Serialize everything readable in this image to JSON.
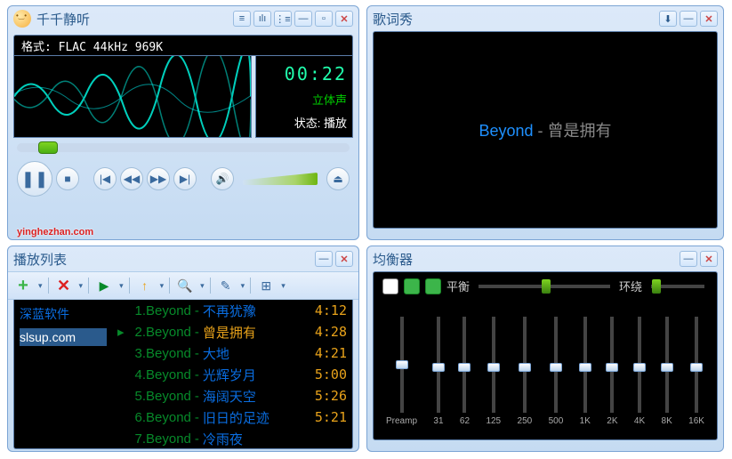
{
  "player": {
    "title": "千千静听",
    "format": "格式: FLAC 44kHz 969K",
    "time": "00:22",
    "stereo": "立体声",
    "status": "状态: 播放",
    "watermark": "yinghezhan.com"
  },
  "lyric": {
    "title": "歌词秀",
    "current_artist": "Beyond",
    "sep": " - ",
    "current_song": "曾是拥有"
  },
  "playlist": {
    "title": "播放列表",
    "side": [
      {
        "label": "深蓝软件"
      },
      {
        "label": "slsup.com",
        "selected": true
      }
    ],
    "tracks": [
      {
        "n": "1",
        "artist": "Beyond",
        "name": "不再犹豫",
        "dur": "4:12",
        "current": false
      },
      {
        "n": "2",
        "artist": "Beyond",
        "name": "曾是拥有",
        "dur": "4:28",
        "current": true
      },
      {
        "n": "3",
        "artist": "Beyond",
        "name": "大地",
        "dur": "4:21",
        "current": false
      },
      {
        "n": "4",
        "artist": "Beyond",
        "name": "光辉岁月",
        "dur": "5:00",
        "current": false
      },
      {
        "n": "5",
        "artist": "Beyond",
        "name": "海阔天空",
        "dur": "5:26",
        "current": false
      },
      {
        "n": "6",
        "artist": "Beyond",
        "name": "旧日的足迹",
        "dur": "5:21",
        "current": false
      },
      {
        "n": "7",
        "artist": "Beyond",
        "name": "冷雨夜",
        "dur": "",
        "current": false
      }
    ]
  },
  "eq": {
    "title": "均衡器",
    "balance_label": "平衡",
    "surround_label": "环绕",
    "bands": [
      "Preamp",
      "31",
      "62",
      "125",
      "250",
      "500",
      "1K",
      "2K",
      "4K",
      "8K",
      "16K"
    ]
  }
}
